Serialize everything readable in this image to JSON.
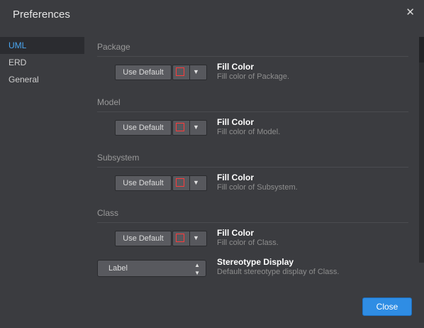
{
  "window": {
    "title": "Preferences",
    "close_glyph": "✕"
  },
  "sidebar": {
    "items": [
      {
        "label": "UML",
        "active": true
      },
      {
        "label": "ERD",
        "active": false
      },
      {
        "label": "General",
        "active": false
      }
    ]
  },
  "sections": [
    {
      "header": "Package",
      "props": [
        {
          "kind": "color",
          "button_label": "Use Default",
          "title": "Fill Color",
          "description": "Fill color of Package."
        }
      ]
    },
    {
      "header": "Model",
      "props": [
        {
          "kind": "color",
          "button_label": "Use Default",
          "title": "Fill Color",
          "description": "Fill color of Model."
        }
      ]
    },
    {
      "header": "Subsystem",
      "props": [
        {
          "kind": "color",
          "button_label": "Use Default",
          "title": "Fill Color",
          "description": "Fill color of Subsystem."
        }
      ]
    },
    {
      "header": "Class",
      "props": [
        {
          "kind": "color",
          "button_label": "Use Default",
          "title": "Fill Color",
          "description": "Fill color of Class."
        },
        {
          "kind": "select",
          "value": "Label",
          "title": "Stereotype Display",
          "description": "Default stereotype display of Class."
        }
      ]
    }
  ],
  "footer": {
    "close_label": "Close"
  },
  "colors": {
    "accent": "#2f8de4",
    "swatch": "#ff3b3b",
    "active_nav": "#4aa6f0"
  }
}
